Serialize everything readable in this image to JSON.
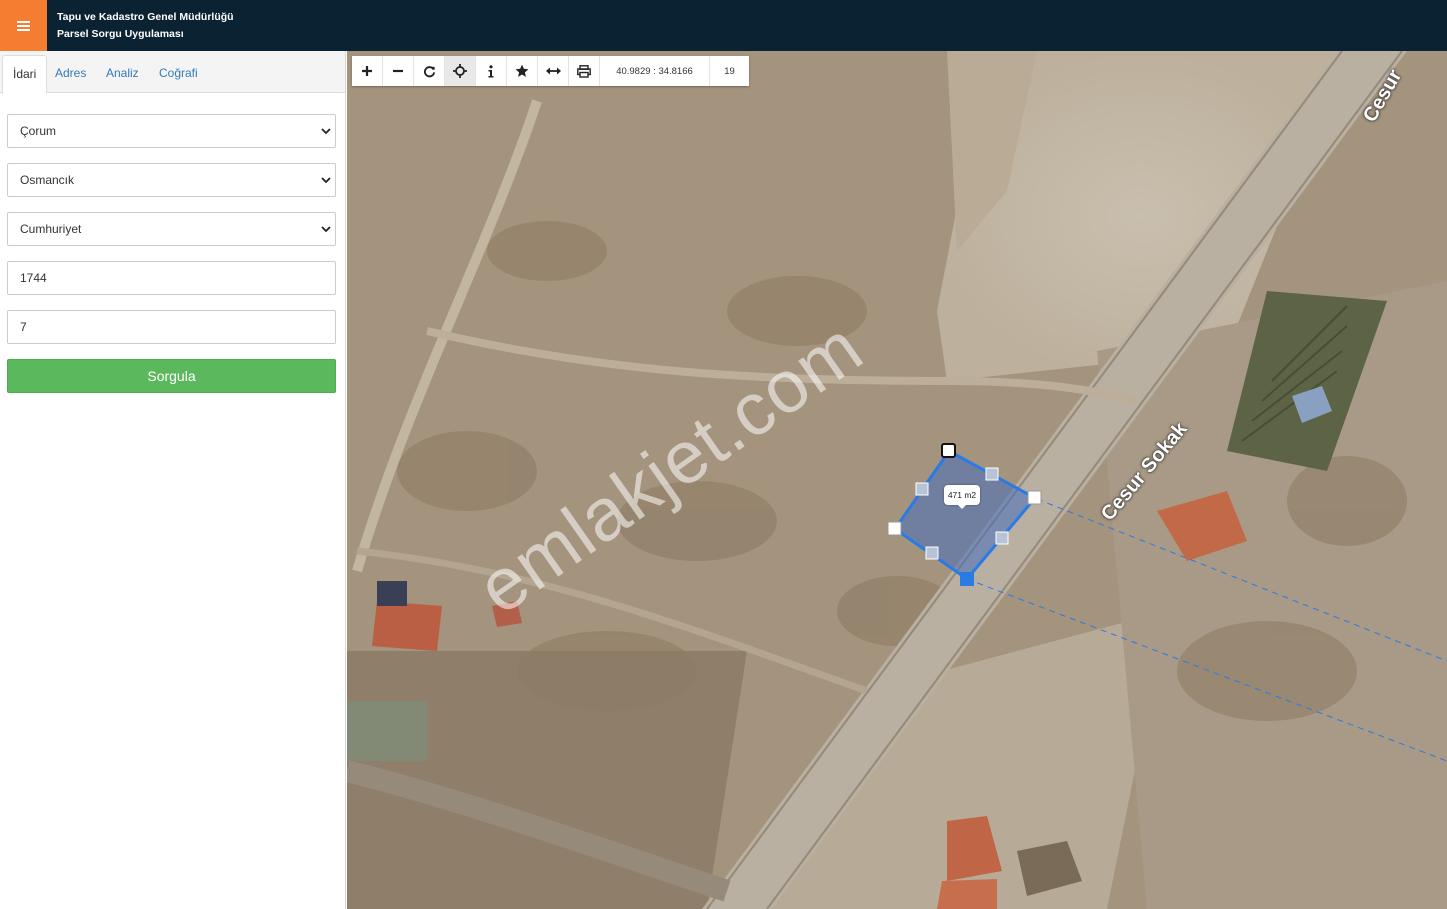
{
  "header": {
    "title_line1": "Tapu ve Kadastro Genel Müdürlüğü",
    "title_line2": "Parsel Sorgu Uygulaması",
    "accent_color": "#f47d31",
    "bg_color": "#0b2233"
  },
  "sidebar": {
    "tabs": [
      {
        "label": "İdari",
        "active": true
      },
      {
        "label": "Adres",
        "active": false
      },
      {
        "label": "Analiz",
        "active": false
      },
      {
        "label": "Coğrafi",
        "active": false
      }
    ],
    "province": {
      "value": "Çorum"
    },
    "district": {
      "value": "Osmancık"
    },
    "neighborhood": {
      "value": "Cumhuriyet"
    },
    "block": {
      "value": "1744"
    },
    "parcel": {
      "value": "7"
    },
    "submit_label": "Sorgula"
  },
  "toolbar": {
    "buttons": [
      "zoom-in-icon",
      "zoom-out-icon",
      "refresh-icon",
      "locate-icon",
      "info-icon",
      "favorite-icon",
      "measure-icon",
      "print-icon"
    ],
    "coordinates": "40.9829 : 34.8166",
    "zoom_level": "19"
  },
  "map": {
    "area_label": "471 m2",
    "road_label_1": "Cesur Sokak",
    "road_label_2": "Cesur",
    "watermark": "emlakjet.com",
    "parcel_color": "#2b7be4"
  }
}
